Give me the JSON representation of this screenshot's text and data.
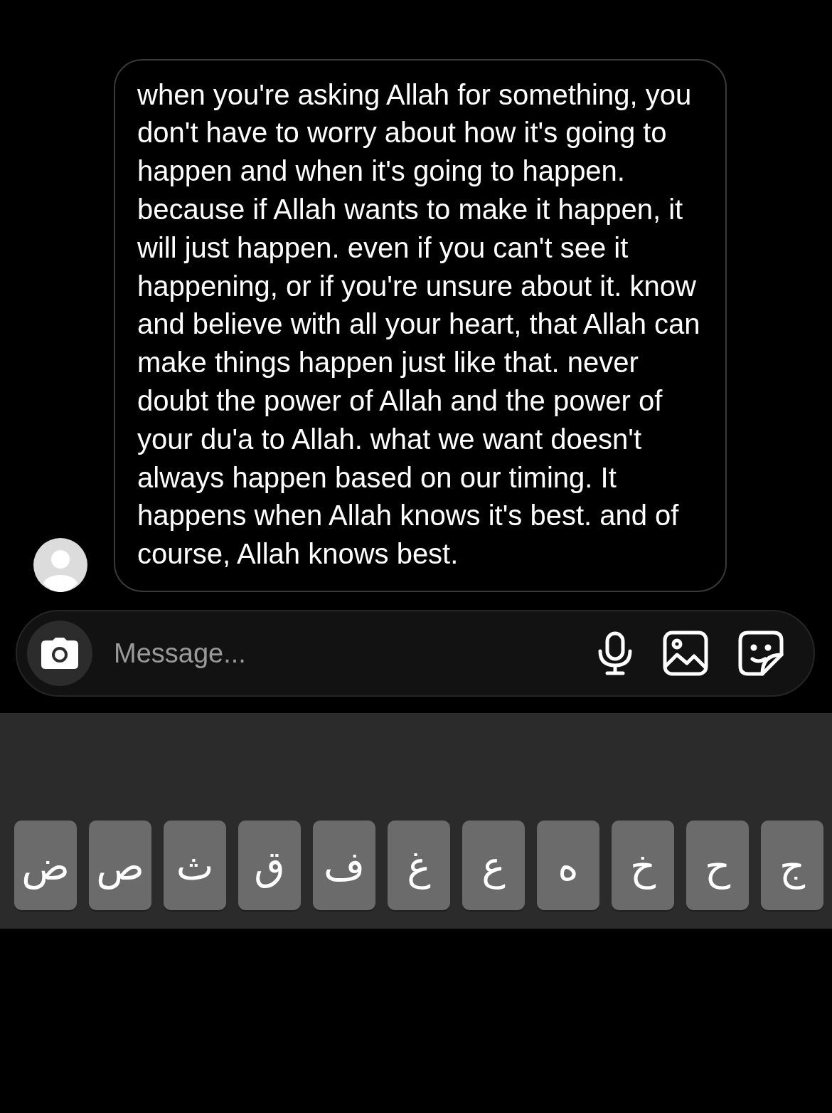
{
  "message": {
    "text": "when you're asking Allah for something, you don't have to worry about how it's going to happen and when it's going to happen. because if Allah wants to make it happen, it will just happen. even if you can't see it happening, or if you're unsure about it. know and believe with all your heart, that Allah can make things happen just like that. never doubt the power of Allah and the power of your du'a to Allah. what we want doesn't always happen based on our timing. It happens when Allah knows it's best. and of course, Allah knows best."
  },
  "composer": {
    "placeholder": "Message..."
  },
  "keyboard": {
    "keys": [
      "ج",
      "ح",
      "خ",
      "ه",
      "ع",
      "غ",
      "ف",
      "ق",
      "ث",
      "ص",
      "ض"
    ]
  }
}
